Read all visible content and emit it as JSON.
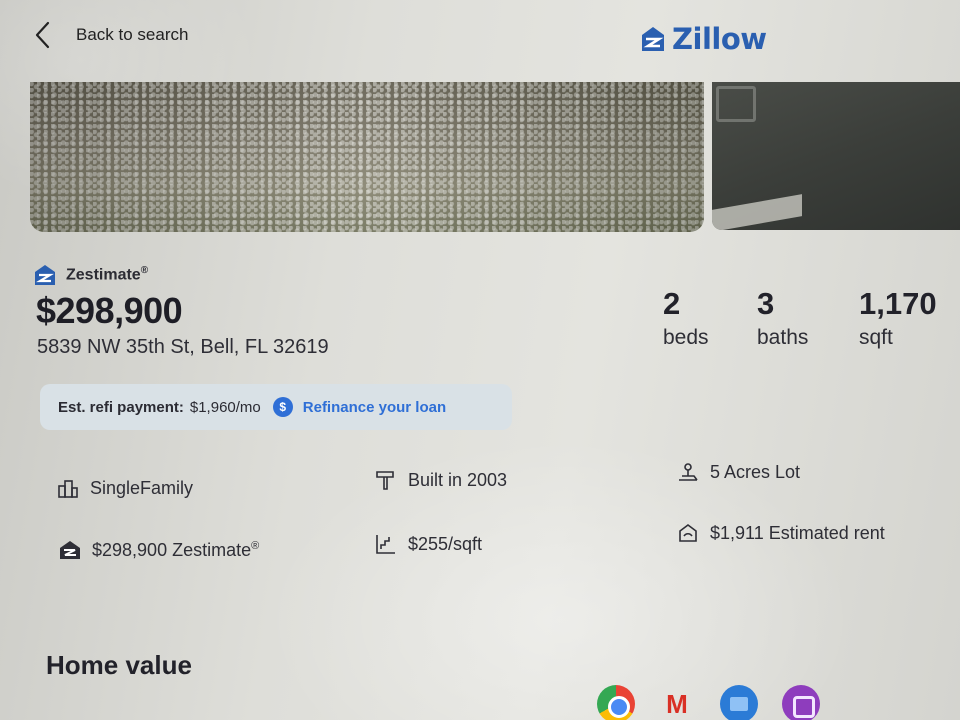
{
  "header": {
    "back_label": "Back to search",
    "logo_text": "Zillow"
  },
  "summary": {
    "zestimate_label": "Zestimate",
    "registered_mark": "®",
    "price": "$298,900",
    "address": "5839 NW 35th St, Bell, FL 32619"
  },
  "facts": [
    {
      "value": "2",
      "label": "beds"
    },
    {
      "value": "3",
      "label": "baths"
    },
    {
      "value": "1,170",
      "label": "sqft"
    }
  ],
  "refi": {
    "label": "Est. refi payment:",
    "value": "$1,960/mo",
    "icon_text": "$",
    "link": "Refinance your loan"
  },
  "details": {
    "type": "SingleFamily",
    "built": "Built in 2003",
    "lot": "5 Acres Lot",
    "zestimate": "$298,900 Zestimate",
    "price_per_sqft": "$255/sqft",
    "rent": "$1,911 Estimated rent"
  },
  "section_title": "Home value",
  "taskbar": {
    "gmail_glyph": "M",
    "icons": [
      "chrome-icon",
      "gmail-icon",
      "files-icon",
      "app-icon"
    ]
  },
  "colors": {
    "brand_blue": "#2a5fb0",
    "link_blue": "#2f6fd6",
    "refi_bg": "#d9e1e6"
  }
}
